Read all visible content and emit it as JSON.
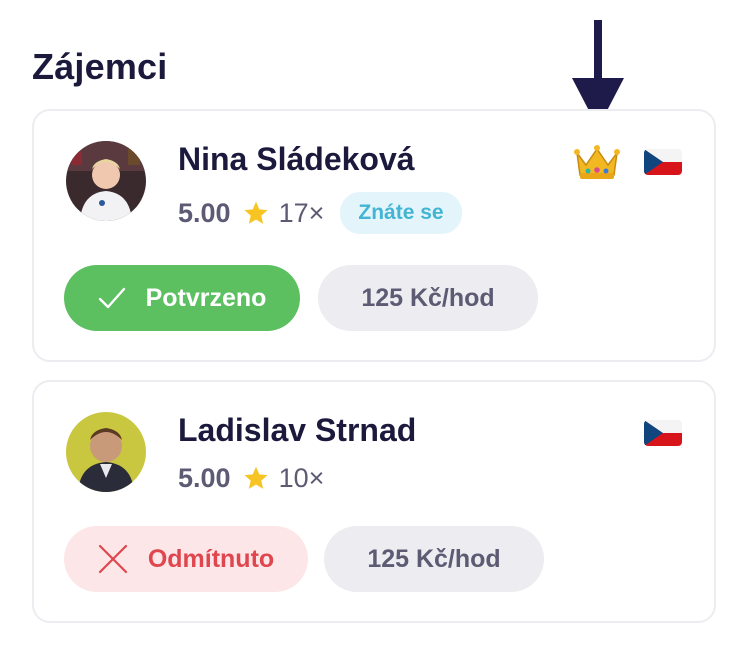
{
  "section": {
    "title": "Zájemci"
  },
  "applicants": [
    {
      "name": "Nina Sládeková",
      "rating": "5.00",
      "count": "17×",
      "badge": "Znáte se",
      "has_crown": true,
      "flag": "czech-flag",
      "status": "Potvrzeno",
      "status_type": "confirmed",
      "price": "125 Kč/hod"
    },
    {
      "name": "Ladislav Strnad",
      "rating": "5.00",
      "count": "10×",
      "flag": "czech-flag",
      "status": "Odmítnuto",
      "status_type": "rejected",
      "price": "125 Kč/hod"
    }
  ],
  "colors": {
    "confirmed": "#5cbf60",
    "rejected_text": "#e0464e",
    "rejected_bg": "#fde6e8",
    "badge_bg": "#e3f5fa",
    "badge_text": "#44b4d4",
    "arrow": "#1e1b4b"
  },
  "icons": {
    "annotation": "down-arrow-icon",
    "crown": "crown-icon",
    "star": "star-icon",
    "confirmed": "check-icon",
    "rejected": "close-icon"
  }
}
